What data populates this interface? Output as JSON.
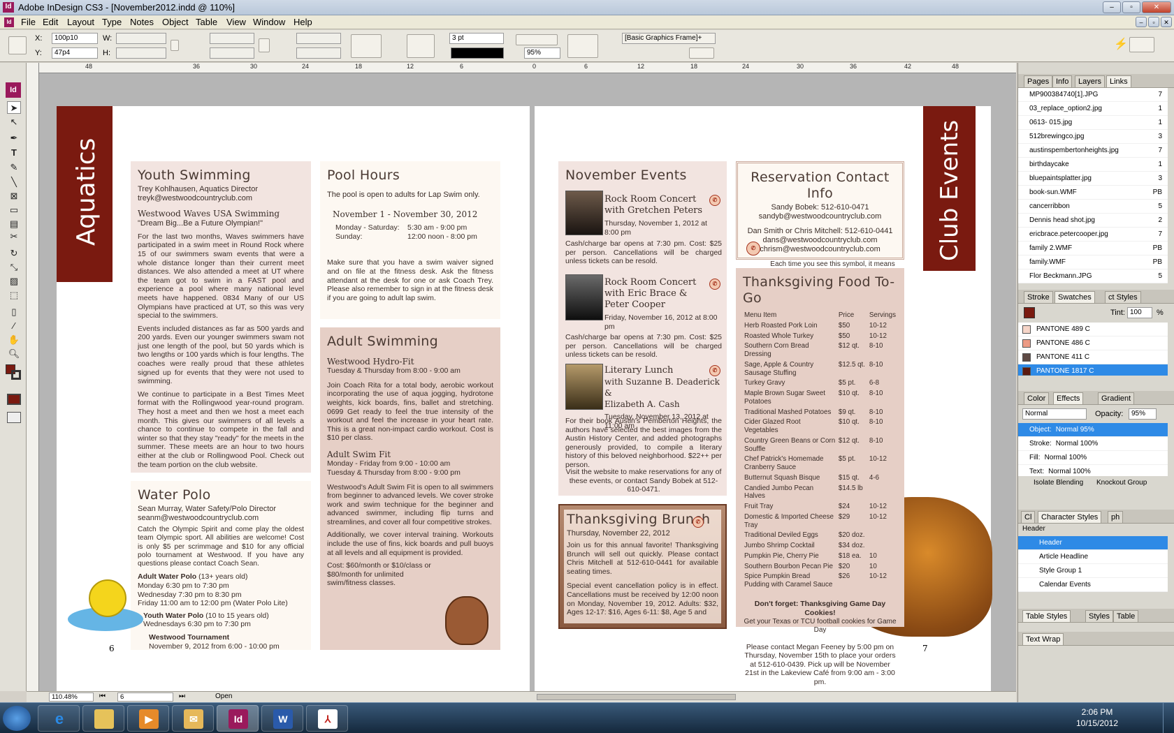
{
  "window": {
    "title": "Adobe InDesign CS3 - [November2012.indd @ 110%]",
    "app_icon": "Id"
  },
  "menu": [
    "File",
    "Edit",
    "Layout",
    "Type",
    "Notes",
    "Object",
    "Table",
    "View",
    "Window",
    "Help"
  ],
  "control": {
    "x_label": "X:",
    "x_value": "100p10",
    "y_label": "Y:",
    "y_value": "47p4",
    "w_label": "W:",
    "h_label": "H:",
    "stroke_weight": "3 pt",
    "opacity": "95%",
    "object_style": "[Basic Graphics Frame]+"
  },
  "ruler_top": [
    "48",
    "36",
    "30",
    "24",
    "18",
    "12",
    "6",
    "0",
    "6",
    "12",
    "18",
    "24",
    "30",
    "36",
    "42",
    "48"
  ],
  "status": {
    "zoom": "110.48%",
    "page": "6",
    "state": "Open"
  },
  "spread": {
    "left_tab": "Aquatics",
    "right_tab": "Club Events",
    "page_num_left": "6",
    "page_num_right": "7",
    "youth": {
      "title": "Youth Swimming",
      "line1": "Trey Kohlhausen, Aquatics Director",
      "line2": "treyk@westwoodcountryclub.com",
      "sub": "Westwood Waves USA Swimming",
      "quote": "\"Dream Big...Be a Future Olympian!\"",
      "p1": "For the last two months, Waves swimmers have participated in a swim meet in Round Rock where 15 of our swimmers swam events that were a whole distance longer than their current meet distances. We also attended a meet at UT where the team got to swim in a FAST pool and experience a pool where many national level meets have happened. 0834 Many of our US Olympians have practiced at UT, so this was very special to the swimmers.",
      "p2": "Events included distances as far as 500 yards and 200 yards. Even our younger swimmers swam not just one length of the pool, but 50 yards which is two lengths or 100 yards which is four lengths.  The coaches were really proud that these athletes signed up for events that they were not used to swimming.",
      "p3": "We continue to participate in a Best Times Meet format with the Rollingwood year-round program. They host a meet and then we host a meet each month. This gives our swimmers of all levels a chance to continue to compete in the fall and winter so that they stay \"ready\" for the meets in the summer. These meets are an hour to two hours either at the club or Rollingwood Pool. Check out the team portion on the club website."
    },
    "polo": {
      "title": "Water Polo",
      "line1": "Sean Murray, Water Safety/Polo Director",
      "line2": "seanm@westwoodcountryclub.com",
      "p1": "Catch the Olympic Spirit and come play the oldest team Olympic sport. All abilities are welcome! Cost is only $5 per scrimmage and $10 for any official polo tournament at Westwood. If you have any questions please contact Coach Sean.",
      "adult_h": "Adult Water Polo",
      "adult_age": " (13+ years old)",
      "adult_l1": "Monday 6:30 pm to 7:30 pm",
      "adult_l2": "Wednesday 7:30 pm to 8:30 pm",
      "adult_l3": "Friday 11:00 am to 12:00 pm (Water Polo Lite)",
      "youth_h": "Youth Water Polo",
      "youth_age": " (10 to 15 years old)",
      "youth_l1": "Wednesdays 6:30 pm to 7:30 pm",
      "tour_h": "Westwood Tournament",
      "tour_l1": "November 9, 2012 from 6:00 - 10:00 pm"
    },
    "pool": {
      "title": "Pool Hours",
      "intro": "The pool is open to adults for Lap Swim only.",
      "range": "November 1 - November 30, 2012",
      "r1a": "Monday - Saturday:",
      "r1b": "5:30 am - 9:00 pm",
      "r2a": "Sunday:",
      "r2b": "12:00 noon - 8:00 pm",
      "p1": "Make sure that you have a swim waiver signed and on file at the fitness desk. Ask the fitness attendant at the desk for one or ask Coach Trey. Please also remember to sign in at the fitness desk if you are going to adult lap swim."
    },
    "adult": {
      "title": "Adult Swimming",
      "h1": "Westwood Hydro-Fit",
      "h1s": "Tuesday & Thursday from 8:00 - 9:00 am",
      "p1": "Join Coach Rita for a total body, aerobic workout incorporating the use of aqua jogging, hydrotone weights, kick boards, fins, ballet and stretching. 0699 Get ready to feel the true intensity of the workout and feel the increase in your heart rate. This is a great non-impact cardio workout. Cost is $10 per class.",
      "h2": "Adult Swim Fit",
      "h2s1": "Monday - Friday from 9:00 - 10:00 am",
      "h2s2": "Tuesday & Thursday from 8:00 - 9:00 pm",
      "p2": "Westwood's Adult Swim Fit is open to all swimmers from beginner to advanced levels. We cover stroke work and swim technique for the beginner and advanced swimmer, including flip turns and streamlines, and cover all four competitive strokes.",
      "p3": "Additionally, we cover interval training. Workouts include the use of fins, kick boards and pull buoys at all levels and all equipment is provided.",
      "p4": "Cost: $60/month or $10/class or $80/month for unlimited swim/fitness classes."
    },
    "nov": {
      "title": "November Events",
      "e1t": "Rock Room Concert",
      "e1w": "with Gretchen Peters",
      "e1d": "Thursday, November 1, 2012 at 8:00 pm",
      "e1p": "Cash/charge bar opens at 7:30 pm. Cost: $25 per person. Cancellations will be charged unless tickets can be resold.",
      "e2t": "Rock Room Concert",
      "e2w": "with Eric Brace &",
      "e2w2": "Peter Cooper",
      "e2d": "Friday, November 16, 2012 at 8:00 pm",
      "e2p": "Cash/charge bar opens at 7:30 pm. Cost: $25 per person. Cancellations will be charged unless tickets can be resold.",
      "e3t": "Literary Lunch",
      "e3w": "with Suzanne B. Deaderick &",
      "e3w2": "Elizabeth A. Cash",
      "e3d": "Tuesday, November 13, 2012 at 11:00 am",
      "e3p": "For their book Austin's Pemberton Heights, the authors have selected the best images from the Austin History Center, and added photographs generously provided, to compile a literary history of this beloved neighborhood. $22++ per person.",
      "e3p2": "Visit the website to make reservations for any of these events, or contact Sandy Bobek at 512-610-0471."
    },
    "brunch": {
      "title": "Thanksgiving Brunch",
      "date": "Thursday, November 22, 2012",
      "p1": "Join us for this annual favorite! Thanksgiving Brunch will sell out quickly. Please contact Chris Mitchell at 512-610-0441 for available seating times.",
      "p2": "Special event cancellation policy is in effect. Cancellations must be received by 12:00 noon on Monday, November 19, 2012. Adults: $32, Ages 12-17: $16, Ages 6-11: $8, Age 5 and"
    },
    "resv": {
      "title": "Reservation Contact Info",
      "l1": "Sandy Bobek: 512-610-0471",
      "l2": "sandyb@westwoodcountryclub.com",
      "l3": "Dan Smith or Chris Mitchell: 512-610-0441",
      "l4": "dans@westwoodcountryclub.com",
      "l5": "chrism@westwoodcountryclub.com",
      "note": "Each time you see this symbol, it means Westwood's cancellation policy is in place."
    },
    "food": {
      "title": "Thanksgiving Food To-Go",
      "headers": [
        "Menu Item",
        "Price",
        "Servings"
      ],
      "rows": [
        [
          "Herb Roasted Pork Loin",
          "$50",
          "10-12"
        ],
        [
          "Roasted Whole Turkey",
          "$50",
          "10-12"
        ],
        [
          "Southern Corn Bread Dressing",
          "$12 qt.",
          "8-10"
        ],
        [
          "Sage, Apple & Country Sausage Stuffing",
          "$12.5 qt.",
          "8-10"
        ],
        [
          "Turkey Gravy",
          "$5 pt.",
          "6-8"
        ],
        [
          "Maple Brown Sugar Sweet Potatoes",
          "$10 qt.",
          "8-10"
        ],
        [
          "Traditional Mashed Potatoes",
          "$9 qt.",
          "8-10"
        ],
        [
          "Cider Glazed Root Vegetables",
          "$10 qt.",
          "8-10"
        ],
        [
          "Country Green Beans or Corn Souffle",
          "$12 qt.",
          "8-10"
        ],
        [
          "Chef Patrick's Homemade Cranberry Sauce",
          "$5 pt.",
          "10-12"
        ],
        [
          "Butternut Squash Bisque",
          "$15 qt.",
          "4-6"
        ],
        [
          "Candied Jumbo Pecan Halves",
          "$14.5 lb",
          ""
        ],
        [
          "Fruit Tray",
          "$24",
          "10-12"
        ],
        [
          "Domestic & Imported Cheese Tray",
          "$29",
          "10-12"
        ],
        [
          "Traditional Deviled Eggs",
          "$20 doz.",
          ""
        ],
        [
          "Jumbo Shrimp Cocktail",
          "$34 doz.",
          ""
        ],
        [
          "Pumpkin Pie, Cherry Pie",
          "$18 ea.",
          "10"
        ],
        [
          "Southern Bourbon Pecan Pie",
          "$20",
          "10"
        ],
        [
          "Spice Pumpkin Bread Pudding with Caramel Sauce",
          "$26",
          "10-12"
        ]
      ],
      "f1": "Don't forget: Thanksgiving Game Day Cookies!",
      "f2": "Get your Texas or TCU football cookies for Game Day",
      "f3": "Please contact Megan Feeney by 5:00 pm on Thursday, November 15th to place your orders at 512-610-0439. Pick up will be November 21st in the Lakeview Café from 9:00 am - 3:00 pm."
    }
  },
  "panels": {
    "links_tabs": [
      "Pages",
      "Info",
      "Layers",
      "Links"
    ],
    "links": [
      [
        "MP900384740[1].JPG",
        "7"
      ],
      [
        "03_replace_option2.jpg",
        "1"
      ],
      [
        "0613- 015.jpg",
        "1"
      ],
      [
        "512brewingco.jpg",
        "3"
      ],
      [
        "austinspembertonheights.jpg",
        "7"
      ],
      [
        "birthdaycake",
        "1"
      ],
      [
        "bluepaintsplatter.jpg",
        "3"
      ],
      [
        "book-sun.WMF",
        "PB"
      ],
      [
        "cancerribbon",
        "5"
      ],
      [
        "Dennis head shot.jpg",
        "2"
      ],
      [
        "ericbrace.petercooper.jpg",
        "7"
      ],
      [
        "family 2.WMF",
        "PB"
      ],
      [
        "family.WMF",
        "PB"
      ],
      [
        "Flor Beckmann.JPG",
        "5"
      ]
    ],
    "swatch_tabs": [
      "Stroke",
      "Swatches",
      "ct Styles"
    ],
    "tint_label": "Tint:",
    "tint": "100",
    "pct": "%",
    "swatches": [
      {
        "name": "PANTONE 489 C",
        "color": "#f6d5c8"
      },
      {
        "name": "PANTONE 486 C",
        "color": "#ec9a84"
      },
      {
        "name": "PANTONE 411 C",
        "color": "#5e4a44"
      },
      {
        "name": "PANTONE 1817 C",
        "color": "#5b1a10"
      }
    ],
    "effects_tabs": [
      "Color",
      "Effects",
      "Gradient"
    ],
    "blend": "Normal",
    "opacity_label": "Opacity:",
    "opacity": "95%",
    "effects_rows": [
      [
        "Object:",
        "Normal 95%"
      ],
      [
        "Stroke:",
        "Normal 100%"
      ],
      [
        "Fill:",
        "Normal 100%"
      ],
      [
        "Text:",
        "Normal 100%"
      ]
    ],
    "isolate": "Isolate Blending",
    "knockout": "Knockout Group",
    "char_tabs": [
      "Cl",
      "Character Styles",
      "ph"
    ],
    "char_head": "Header",
    "char_styles": [
      "Header",
      "Article Headline",
      "Style Group 1",
      "Calendar Events"
    ],
    "table_tabs": [
      "Table Styles",
      "Styles",
      "Table"
    ],
    "wrap_tab": "Text Wrap"
  },
  "taskbar": {
    "time": "2:06 PM",
    "date": "10/15/2012"
  }
}
